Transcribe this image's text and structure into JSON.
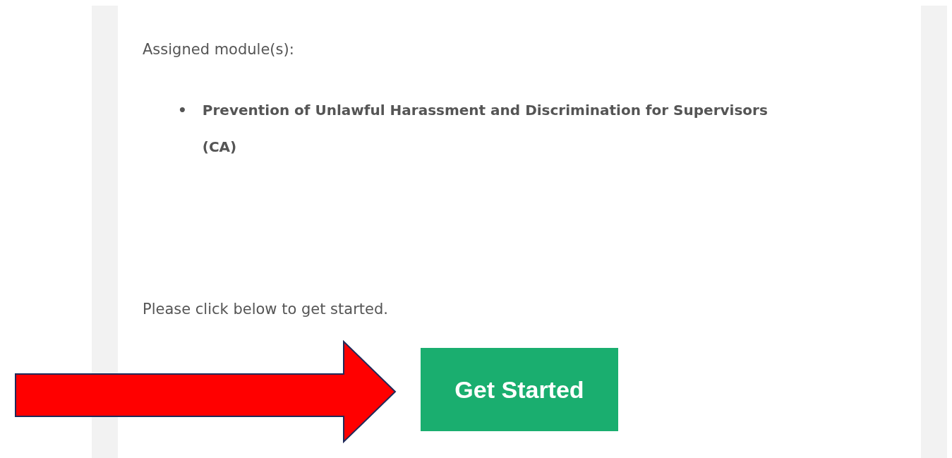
{
  "intro": "Assigned module(s):",
  "modules": [
    {
      "marker": "•",
      "text": "Prevention of Unlawful Harassment and Discrimination for Supervisors (CA)"
    }
  ],
  "prompt": "Please click below to get started.",
  "button": "Get Started"
}
